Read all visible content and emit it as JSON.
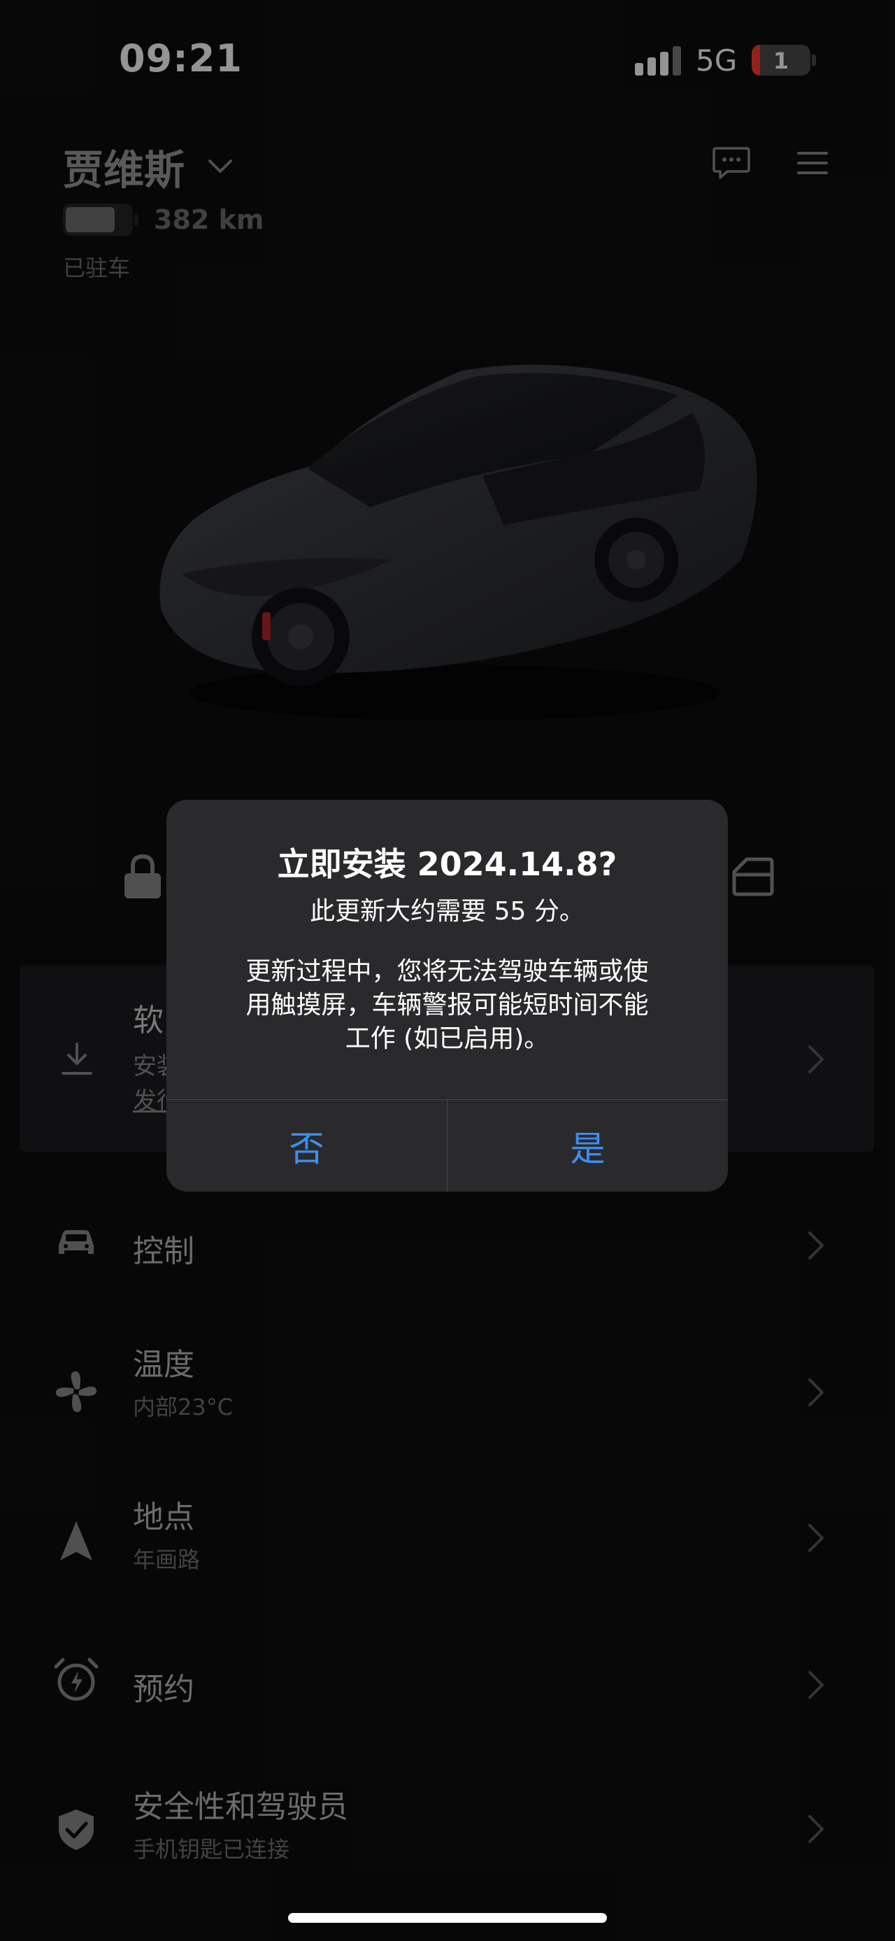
{
  "status_bar": {
    "time": "09:21",
    "network": "5G",
    "battery_level": "1"
  },
  "header": {
    "vehicle_name": "贾维斯",
    "range": "382 km",
    "status": "已驻车"
  },
  "software_update": {
    "title": "软",
    "subtitle": "安装",
    "link": "发行"
  },
  "menu": [
    {
      "label": "控制",
      "sub": ""
    },
    {
      "label": "温度",
      "sub": "内部23°C"
    },
    {
      "label": "地点",
      "sub": "年画路"
    },
    {
      "label": "预约",
      "sub": ""
    },
    {
      "label": "安全性和驾驶员",
      "sub": "手机钥匙已连接"
    }
  ],
  "dialog": {
    "title": "立即安装 2024.14.8?",
    "subtitle": "此更新大约需要 55 分。",
    "body_line1": "更新过程中，您将无法驾驶车辆或使",
    "body_line2": "用触摸屏，车辆警报可能短时间不能",
    "body_line3": "工作 (如已启用)。",
    "no_label": "否",
    "yes_label": "是"
  },
  "colors": {
    "background": "#0d0d0e",
    "dialog_bg": "#2a2a2c",
    "accent_blue": "#3d8ef0",
    "battery_red": "#ff3b30"
  }
}
